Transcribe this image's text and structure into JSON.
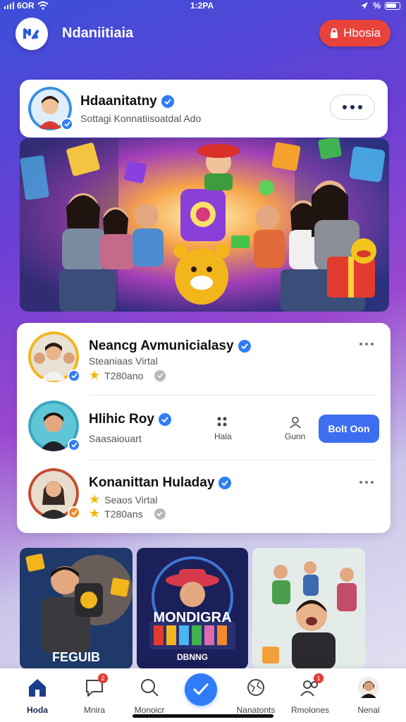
{
  "status_bar": {
    "carrier": "6OR",
    "time": "1:2PA",
    "battery": "%"
  },
  "header": {
    "title": "Ndaniitiaia",
    "action_label": "Hbosia"
  },
  "profile": {
    "name": "Hdaanitatny",
    "subtitle": "Sottagi Konnatiisoatdal Ado"
  },
  "friends": [
    {
      "name": "Neancg Avmunicialasy",
      "subtitle": "Steaniaas Virtal",
      "meta": "T280ano"
    },
    {
      "name": "Hlihic Roy",
      "subtitle": "Saasaiouart",
      "action1": "Hala",
      "action2": "Gunn",
      "follow_label": "Bolt Oon"
    },
    {
      "name": "Konanittan Huladay",
      "subtitle": "Seaos Virtal",
      "meta": "T280ans"
    }
  ],
  "tiles": [
    {
      "caption": "FEGUIB"
    },
    {
      "caption": "MONDIGRA",
      "sub": "DBNNG"
    },
    {
      "caption": ""
    }
  ],
  "nav": [
    {
      "label": "Hoda",
      "icon": "home-icon",
      "badge": ""
    },
    {
      "label": "Mnira",
      "icon": "chat-icon",
      "badge": "2"
    },
    {
      "label": "Monoicr",
      "icon": "search-icon",
      "badge": ""
    },
    {
      "label": "Nanatonts",
      "icon": "globe-icon",
      "badge": ""
    },
    {
      "label": "Rmolones",
      "icon": "group-icon",
      "badge": "1"
    },
    {
      "label": "Nenal",
      "icon": "profile-avatar-icon",
      "badge": ""
    }
  ],
  "colors": {
    "accent": "#2f7cf6",
    "danger": "#e8433a",
    "follow": "#3d6ef0"
  }
}
